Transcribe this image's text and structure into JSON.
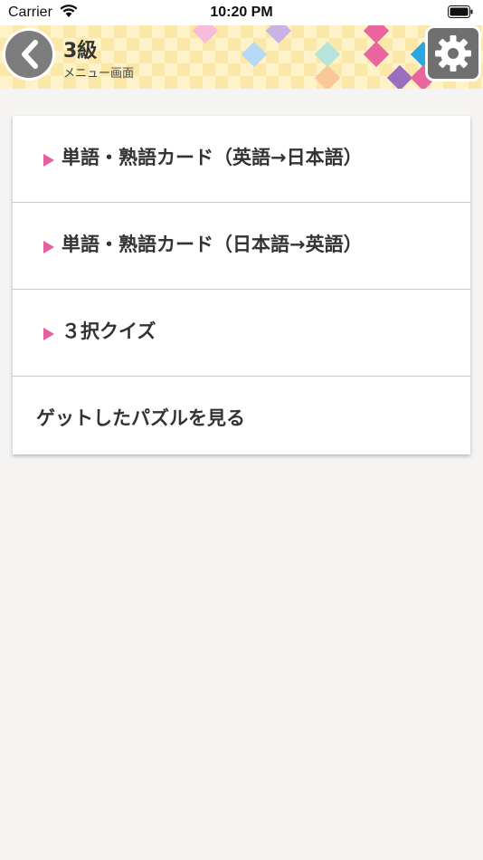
{
  "status_bar": {
    "carrier": "Carrier",
    "time": "10:20 PM"
  },
  "header": {
    "title": "3級",
    "subtitle": "メニュー画面",
    "back_icon": "chevron-left-icon",
    "settings_icon": "gear-icon"
  },
  "menu": {
    "items": [
      {
        "label": "単語・熟語カード（英語→日本語）"
      },
      {
        "label": "単語・熟語カード（日本語→英語）"
      },
      {
        "label": "３択クイズ"
      },
      {
        "label": "ゲットしたパズルを見る"
      }
    ]
  },
  "colors": {
    "accent_arrow": "#e3609c",
    "header_bg": "#fdf2c8",
    "button_gray": "#7d7d7d"
  }
}
